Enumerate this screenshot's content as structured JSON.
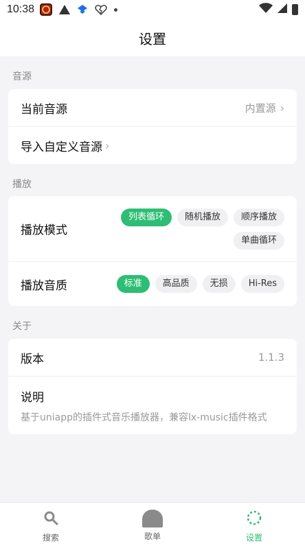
{
  "status_bar": {
    "time": "10:38"
  },
  "header": {
    "title": "设置"
  },
  "source_section": {
    "label": "音源",
    "current_source_label": "当前音源",
    "current_source_value": "内置源",
    "import_label": "导入自定义音源"
  },
  "playback_section": {
    "label": "播放",
    "mode_label": "播放模式",
    "modes": [
      "列表循环",
      "随机播放",
      "顺序播放",
      "单曲循环"
    ],
    "active_mode": "列表循环",
    "quality_label": "播放音质",
    "qualities": [
      "标准",
      "高品质",
      "无损",
      "Hi-Res"
    ],
    "active_quality": "标准"
  },
  "about_section": {
    "label": "关于",
    "version_label": "版本",
    "version_value": "1.1.3",
    "description_label": "说明",
    "description_text": "基于uniapp的插件式音乐播放器，兼容lx-music插件格式"
  },
  "bottom_nav": {
    "items": [
      {
        "label": "搜索",
        "icon": "search-icon"
      },
      {
        "label": "歌单",
        "icon": "playlist-icon"
      },
      {
        "label": "设置",
        "icon": "settings-icon"
      }
    ],
    "active": "设置"
  },
  "colors": {
    "accent": "#2ebd74",
    "background": "#f4f4f6"
  }
}
